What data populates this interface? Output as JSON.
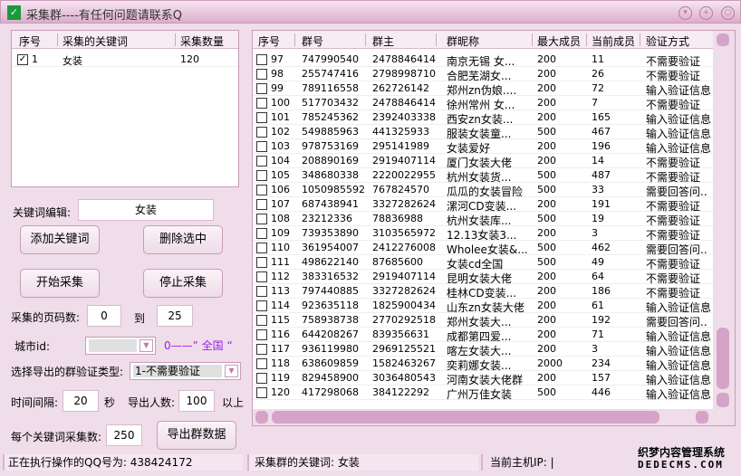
{
  "title": "采集群----有任何问题请联系Q",
  "keywords_table": {
    "headers": [
      "序号",
      "采集的关键词",
      "采集数量"
    ],
    "rows": [
      {
        "checked": true,
        "index": "1",
        "keyword": "女装",
        "count": "120"
      }
    ]
  },
  "keyword_edit": {
    "label": "关键词编辑:",
    "value": "女装"
  },
  "buttons": {
    "add": "添加关键词",
    "delete": "删除选中",
    "start": "开始采集",
    "stop": "停止采集",
    "export": "导出群数据"
  },
  "pages": {
    "label": "采集的页码数:",
    "from": "0",
    "to_label": "到",
    "to": "25"
  },
  "city": {
    "label": "城市id:",
    "value": "",
    "hint": "0——” 全国 “"
  },
  "verify": {
    "label": "选择导出的群验证类型:",
    "value": "1-不需要验证"
  },
  "interval": {
    "label": "时间间隔:",
    "value": "20",
    "unit": "秒",
    "export_label": "导出人数:",
    "export_value": "100",
    "export_unit": "以上"
  },
  "per_keyword": {
    "label": "每个关键词采集数:",
    "value": "250"
  },
  "groups": {
    "headers": [
      "序号",
      "群号",
      "群主",
      "群昵称",
      "最大成员",
      "当前成员",
      "验证方式"
    ],
    "rows": [
      [
        "97",
        "747990540",
        "2478846414",
        "南京无锡 女...",
        "200",
        "11",
        "不需要验证"
      ],
      [
        "98",
        "255747416",
        "2798998710",
        "合肥芜湖女...",
        "200",
        "26",
        "不需要验证"
      ],
      [
        "99",
        "789116558",
        "262726142",
        "郑州zn伪娘....",
        "200",
        "72",
        "输入验证信息"
      ],
      [
        "100",
        "517703432",
        "2478846414",
        "徐州常州 女...",
        "200",
        "7",
        "不需要验证"
      ],
      [
        "101",
        "785245362",
        "2392403338",
        "西安zn女装...",
        "200",
        "165",
        "输入验证信息"
      ],
      [
        "102",
        "549885963",
        "441325933",
        "服装女装童...",
        "500",
        "467",
        "输入验证信息"
      ],
      [
        "103",
        "978753169",
        "295141989",
        "女装爱好",
        "200",
        "196",
        "输入验证信息"
      ],
      [
        "104",
        "208890169",
        "2919407114",
        "厦门女装大佬",
        "200",
        "14",
        "不需要验证"
      ],
      [
        "105",
        "348680338",
        "2220022955",
        "杭州女装货...",
        "500",
        "487",
        "不需要验证"
      ],
      [
        "106",
        "1050985592",
        "767824570",
        "瓜瓜的女装冒险",
        "500",
        "33",
        "需要回答问.."
      ],
      [
        "107",
        "687438941",
        "3327282624",
        "漯河CD变装...",
        "200",
        "191",
        "不需要验证"
      ],
      [
        "108",
        "23212336",
        "78836988",
        "杭州女装库...",
        "500",
        "19",
        "不需要验证"
      ],
      [
        "109",
        "739353890",
        "3103565972",
        "12.13女装3...",
        "200",
        "3",
        "不需要验证"
      ],
      [
        "110",
        "361954007",
        "2412276008",
        "Wholee女装&...",
        "500",
        "462",
        "需要回答问.."
      ],
      [
        "111",
        "498622140",
        "87685600",
        "女装cd全国",
        "500",
        "49",
        "不需要验证"
      ],
      [
        "112",
        "383316532",
        "2919407114",
        "昆明女装大佬",
        "200",
        "64",
        "不需要验证"
      ],
      [
        "113",
        "797440885",
        "3327282624",
        "桂林CD变装...",
        "200",
        "186",
        "不需要验证"
      ],
      [
        "114",
        "923635118",
        "1825900434",
        "山东zn女装大佬",
        "200",
        "61",
        "输入验证信息"
      ],
      [
        "115",
        "758938738",
        "2770292518",
        "郑州女装大...",
        "200",
        "192",
        "需要回答问.."
      ],
      [
        "116",
        "644208267",
        "839356631",
        "成都第四爱...",
        "200",
        "71",
        "输入验证信息"
      ],
      [
        "117",
        "936119980",
        "2969125521",
        "喀左女装大...",
        "200",
        "3",
        "输入验证信息"
      ],
      [
        "118",
        "638609859",
        "1582463267",
        "奕莉娜女装...",
        "2000",
        "234",
        "输入验证信息"
      ],
      [
        "119",
        "829458900",
        "3036480543",
        "河南女装大佬群",
        "200",
        "157",
        "输入验证信息"
      ],
      [
        "120",
        "417298068",
        "384122292",
        "广州万佳女装",
        "500",
        "446",
        "输入验证信息"
      ]
    ]
  },
  "status": {
    "qq": "正在执行操作的QQ号为: 438424172",
    "keyword": "采集群的关键词: 女装",
    "ip": "当前主机IP: |"
  },
  "watermark": {
    "line1": "织梦内容管理系统",
    "line2": "DEDECMS.COM"
  }
}
